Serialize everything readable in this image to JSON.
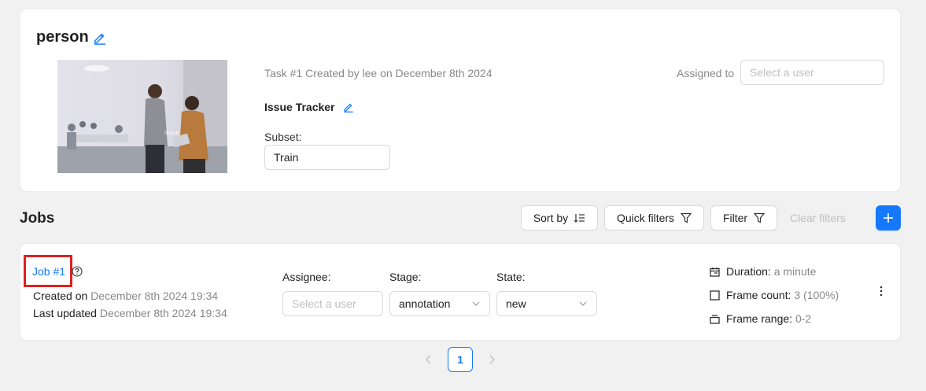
{
  "task": {
    "title": "person",
    "meta": "Task #1 Created by lee on December 8th 2024",
    "issue_tracker_label": "Issue Tracker",
    "subset_label": "Subset:",
    "subset_value": "Train",
    "assigned_label": "Assigned to",
    "assigned_placeholder": "Select a user"
  },
  "jobs_header": {
    "title": "Jobs",
    "sort_label": "Sort by",
    "quick_filters_label": "Quick filters",
    "filter_label": "Filter",
    "clear_filters_label": "Clear filters"
  },
  "job": {
    "name": "Job #1",
    "created_label": "Created on",
    "created_value": "December 8th 2024 19:34",
    "updated_label": "Last updated",
    "updated_value": "December 8th 2024 19:34",
    "assignee_label": "Assignee:",
    "assignee_placeholder": "Select a user",
    "stage_label": "Stage:",
    "stage_value": "annotation",
    "state_label": "State:",
    "state_value": "new",
    "duration_label": "Duration:",
    "duration_value": "a minute",
    "frame_count_label": "Frame count:",
    "frame_count_value": "3 (100%)",
    "frame_range_label": "Frame range:",
    "frame_range_value": "0-2"
  },
  "pagination": {
    "current_page": "1"
  },
  "colors": {
    "accent": "#1677ff",
    "highlight": "#e02020",
    "background": "#f1f1f1"
  }
}
